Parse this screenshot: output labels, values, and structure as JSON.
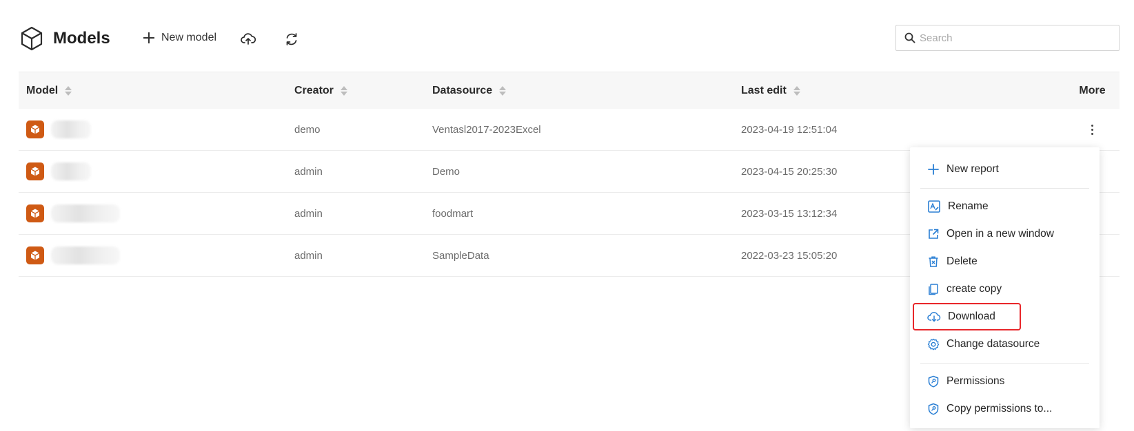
{
  "header": {
    "title": "Models",
    "new_model_label": "New model",
    "search_placeholder": "Search"
  },
  "table": {
    "columns": [
      "Model",
      "Creator",
      "Datasource",
      "Last edit",
      "More"
    ],
    "rows": [
      {
        "creator": "demo",
        "datasource": "Ventasl2017-2023Excel",
        "last_edit": "2023-04-19 12:51:04"
      },
      {
        "creator": "admin",
        "datasource": "Demo",
        "last_edit": "2023-04-15 20:25:30"
      },
      {
        "creator": "admin",
        "datasource": "foodmart",
        "last_edit": "2023-03-15 13:12:34"
      },
      {
        "creator": "admin",
        "datasource": "SampleData",
        "last_edit": "2022-03-23 15:05:20"
      }
    ]
  },
  "menu": {
    "items": [
      {
        "label": "New report",
        "icon": "plus-icon"
      },
      {
        "label": "Rename",
        "icon": "rename-icon"
      },
      {
        "label": "Open in a new window",
        "icon": "external-link-icon"
      },
      {
        "label": "Delete",
        "icon": "trash-icon"
      },
      {
        "label": "create copy",
        "icon": "copy-icon"
      },
      {
        "label": "Download",
        "icon": "cloud-download-icon"
      },
      {
        "label": "Change datasource",
        "icon": "gear-icon"
      },
      {
        "label": "Permissions",
        "icon": "shield-key-icon"
      },
      {
        "label": "Copy permissions to...",
        "icon": "shield-key-icon"
      }
    ],
    "highlighted_item": "Download"
  },
  "colors": {
    "model_icon": "#cf5a14",
    "menu_icon": "#2a7fd4",
    "highlight_border": "#e8262a"
  }
}
